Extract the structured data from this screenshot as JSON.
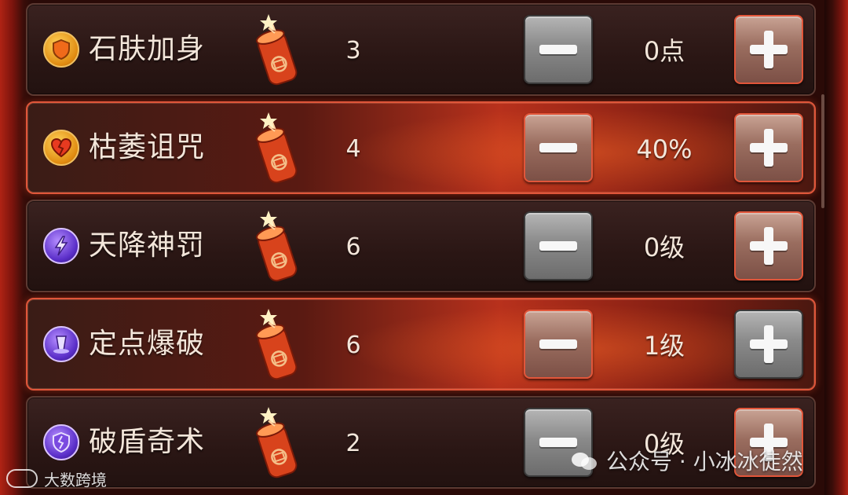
{
  "skills": [
    {
      "name": "石肤加身",
      "icon": "shield-icon",
      "count": "3",
      "value": "0点",
      "active": false,
      "minus_style": "gray",
      "plus_style": "red"
    },
    {
      "name": "枯萎诅咒",
      "icon": "broken-heart-icon",
      "count": "4",
      "value": "40%",
      "active": true,
      "minus_style": "red",
      "plus_style": "red"
    },
    {
      "name": "天降神罚",
      "icon": "lightning-icon",
      "count": "6",
      "value": "0级",
      "active": false,
      "minus_style": "gray",
      "plus_style": "red"
    },
    {
      "name": "定点爆破",
      "icon": "blast-icon",
      "count": "6",
      "value": "1级",
      "active": true,
      "minus_style": "red",
      "plus_style": "gray"
    },
    {
      "name": "破盾奇术",
      "icon": "cracked-shield-icon",
      "count": "2",
      "value": "0级",
      "active": false,
      "minus_style": "gray",
      "plus_style": "red"
    }
  ],
  "watermark": {
    "left": "大数跨境",
    "right": "公众号 · 小冰冰徒然"
  },
  "colors": {
    "row_border_active": "#e0563a",
    "row_border_idle": "#5c3a32",
    "text": "#f3e6da",
    "button_gray": "#8a8a8a",
    "button_red_border": "#e2563a"
  }
}
